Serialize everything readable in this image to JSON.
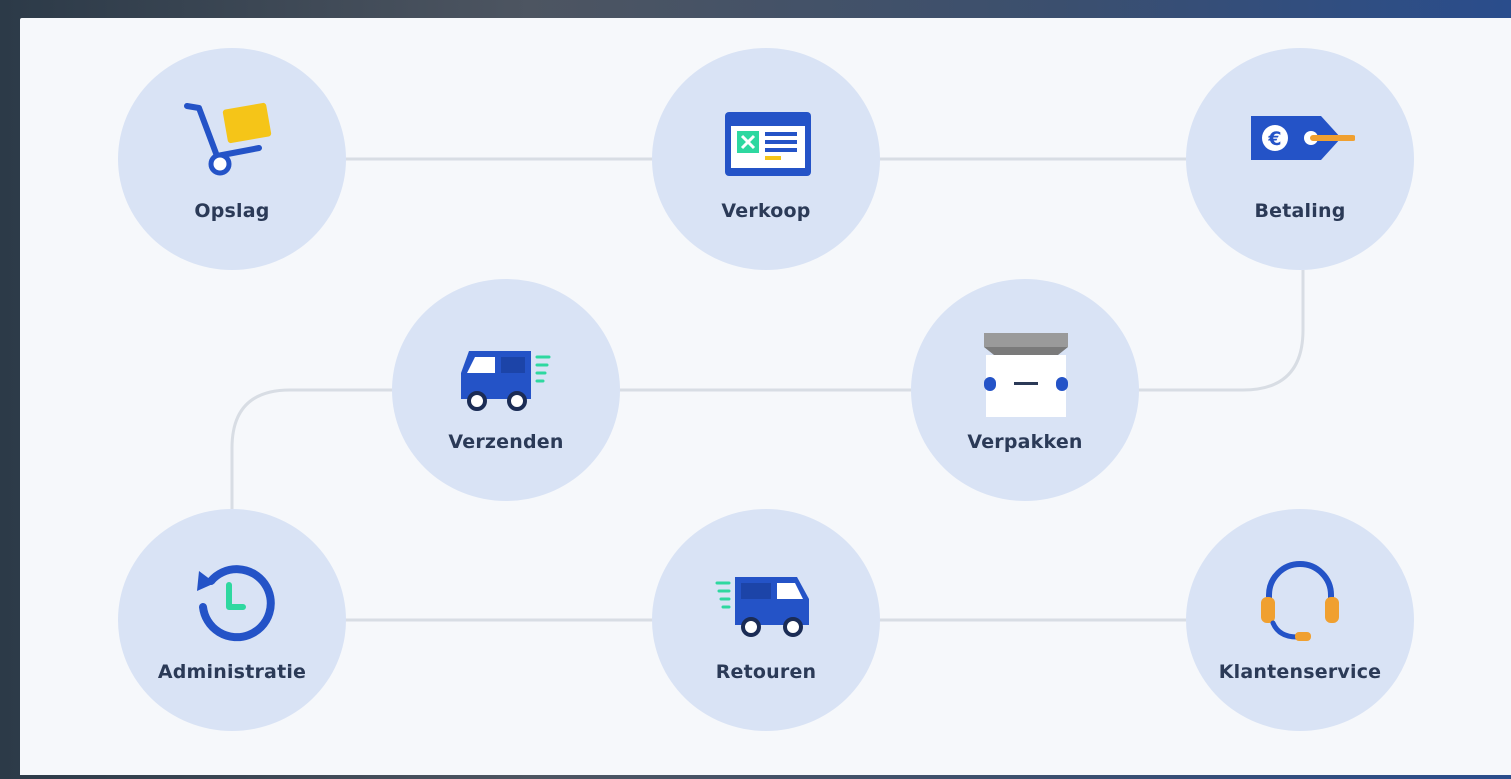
{
  "diagram": {
    "nodes": [
      {
        "id": "opslag",
        "label": "Opslag",
        "icon": "hand-truck-icon"
      },
      {
        "id": "verkoop",
        "label": "Verkoop",
        "icon": "spreadsheet-icon"
      },
      {
        "id": "betaling",
        "label": "Betaling",
        "icon": "euro-price-tag-icon"
      },
      {
        "id": "verzenden",
        "label": "Verzenden",
        "icon": "delivery-van-icon"
      },
      {
        "id": "verpakken",
        "label": "Verpakken",
        "icon": "package-box-icon"
      },
      {
        "id": "administratie",
        "label": "Administratie",
        "icon": "clock-refresh-icon"
      },
      {
        "id": "retouren",
        "label": "Retouren",
        "icon": "return-van-icon"
      },
      {
        "id": "klantenservice",
        "label": "Klantenservice",
        "icon": "headset-icon"
      }
    ],
    "edges": [
      [
        "opslag",
        "verkoop"
      ],
      [
        "verkoop",
        "betaling"
      ],
      [
        "betaling",
        "verpakken"
      ],
      [
        "verpakken",
        "verzenden"
      ],
      [
        "verzenden",
        "administratie"
      ],
      [
        "administratie",
        "retouren"
      ],
      [
        "retouren",
        "klantenservice"
      ]
    ]
  },
  "colors": {
    "node_fill": "#d9e3f5",
    "line": "#d8dde4",
    "label": "#2b3a57",
    "icon_blue": "#2453c7",
    "accent_yellow": "#f5c518",
    "accent_orange": "#f0a030",
    "accent_green": "#2ed8a0"
  }
}
